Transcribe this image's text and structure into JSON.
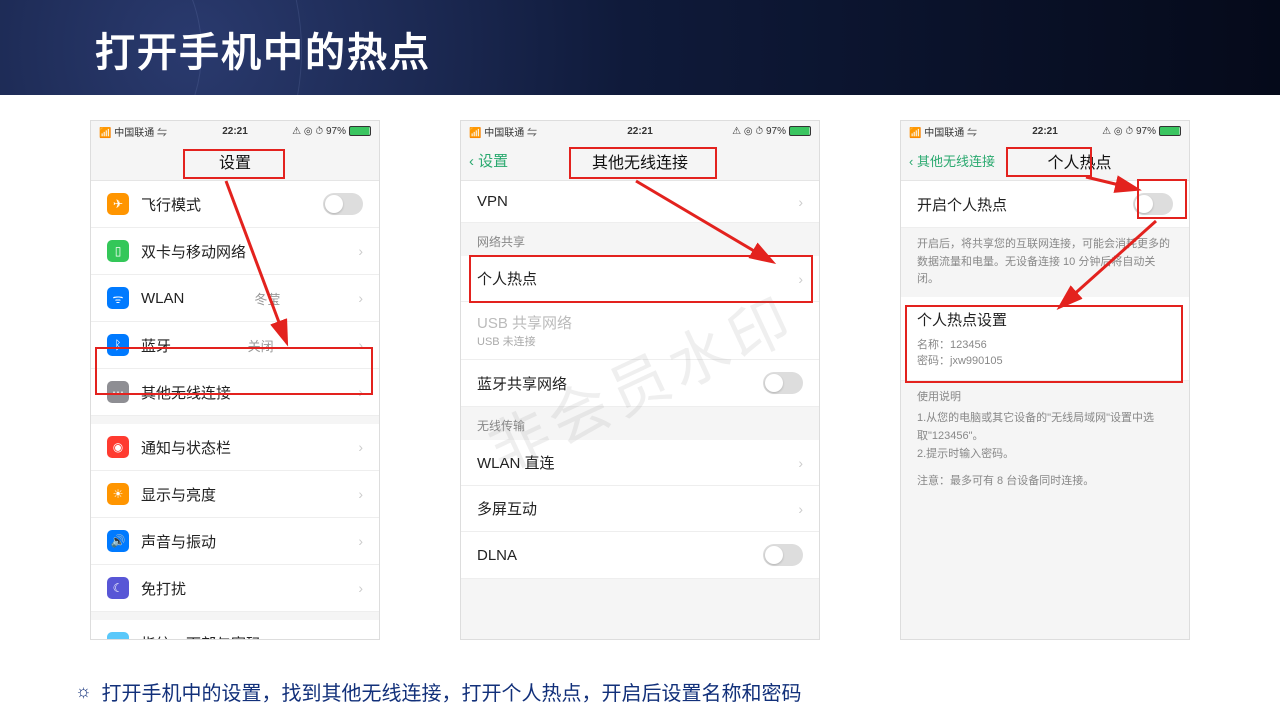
{
  "slide": {
    "title": "打开手机中的热点"
  },
  "status": {
    "carrier": "中国联通",
    "time": "22:21",
    "battery_text": "97%"
  },
  "watermark": "非会员水印",
  "phone1": {
    "nav_title": "设置",
    "items": {
      "airplane": "飞行模式",
      "sim": "双卡与移动网络",
      "wlan": "WLAN",
      "wlan_val": "冬莹",
      "bt": "蓝牙",
      "bt_val": "关闭",
      "other": "其他无线连接",
      "notif": "通知与状态栏",
      "display": "显示与亮度",
      "sound": "声音与振动",
      "dnd": "免打扰",
      "biometric": "指纹、面部与密码"
    }
  },
  "phone2": {
    "back": "设置",
    "nav_title": "其他无线连接",
    "vpn": "VPN",
    "sec_share": "网络共享",
    "hotspot": "个人热点",
    "usb": "USB 共享网络",
    "usb_sub": "USB 未连接",
    "bt_share": "蓝牙共享网络",
    "sec_wireless": "无线传输",
    "wlan_direct": "WLAN 直连",
    "multiscreen": "多屏互动",
    "dlna": "DLNA"
  },
  "phone3": {
    "back": "其他无线连接",
    "nav_title": "个人热点",
    "enable": "开启个人热点",
    "enable_help": "开启后，将共享您的互联网连接，可能会消耗更多的数据流量和电量。无设备连接 10 分钟后将自动关闭。",
    "settings_title": "个人热点设置",
    "name_label": "名称：",
    "name_val": "123456",
    "pwd_label": "密码：",
    "pwd_val": "jxw990105",
    "usage_title": "使用说明",
    "usage_1": "1.从您的电脑或其它设备的\"无线局域网\"设置中选取\"123456\"。",
    "usage_2": "2.提示时输入密码。",
    "usage_note": "注意：最多可有 8 台设备同时连接。"
  },
  "caption": "打开手机中的设置，找到其他无线连接，打开个人热点，开启后设置名称和密码"
}
